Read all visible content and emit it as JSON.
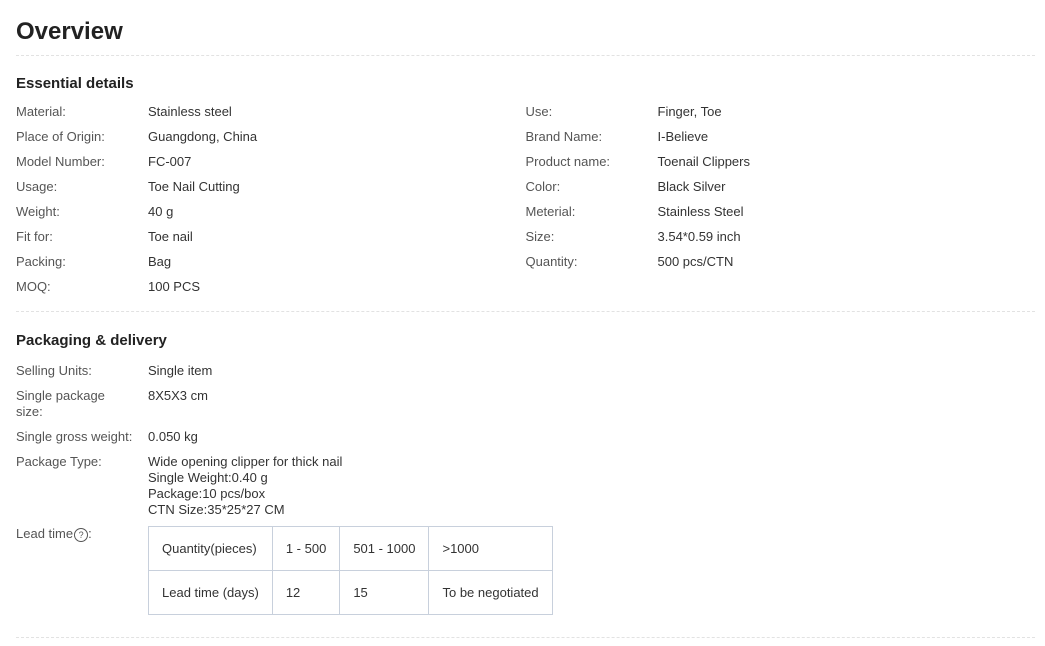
{
  "title": "Overview",
  "essential": {
    "heading": "Essential details",
    "left": [
      {
        "label": "Material:",
        "value": "Stainless steel"
      },
      {
        "label": "Place of Origin:",
        "value": "Guangdong, China"
      },
      {
        "label": "Model Number:",
        "value": "FC-007"
      },
      {
        "label": "Usage:",
        "value": "Toe Nail Cutting"
      },
      {
        "label": "Weight:",
        "value": "40 g"
      },
      {
        "label": "Fit for:",
        "value": "Toe nail"
      },
      {
        "label": "Packing:",
        "value": "Bag"
      },
      {
        "label": "MOQ:",
        "value": "100 PCS"
      }
    ],
    "right": [
      {
        "label": "Use:",
        "value": "Finger, Toe"
      },
      {
        "label": "Brand Name:",
        "value": "I-Believe"
      },
      {
        "label": "Product name:",
        "value": "Toenail Clippers"
      },
      {
        "label": "Color:",
        "value": "Black Silver"
      },
      {
        "label": "Meterial:",
        "value": "Stainless Steel"
      },
      {
        "label": "Size:",
        "value": "3.54*0.59 inch"
      },
      {
        "label": "Quantity:",
        "value": "500 pcs/CTN"
      }
    ]
  },
  "packaging": {
    "heading": "Packaging & delivery",
    "selling_units": {
      "label": "Selling Units:",
      "value": "Single item"
    },
    "package_size": {
      "label_line1": "Single package",
      "label_line2": "size:",
      "value": "8X5X3 cm"
    },
    "gross_weight": {
      "label": "Single gross weight:",
      "value": "0.050 kg"
    },
    "package_type": {
      "label": "Package Type:",
      "lines": [
        "Wide opening clipper for thick nail",
        "Single Weight:0.40 g",
        "Package:10 pcs/box",
        "CTN Size:35*25*27 CM"
      ]
    },
    "lead_time": {
      "label": "Lead time",
      "label_suffix": ":",
      "help_icon": "question-circle-icon",
      "help_glyph": "?",
      "table": [
        [
          "Quantity(pieces)",
          "1 - 500",
          "501 - 1000",
          ">1000"
        ],
        [
          "Lead time (days)",
          "12",
          "15",
          "To be negotiated"
        ]
      ]
    }
  }
}
